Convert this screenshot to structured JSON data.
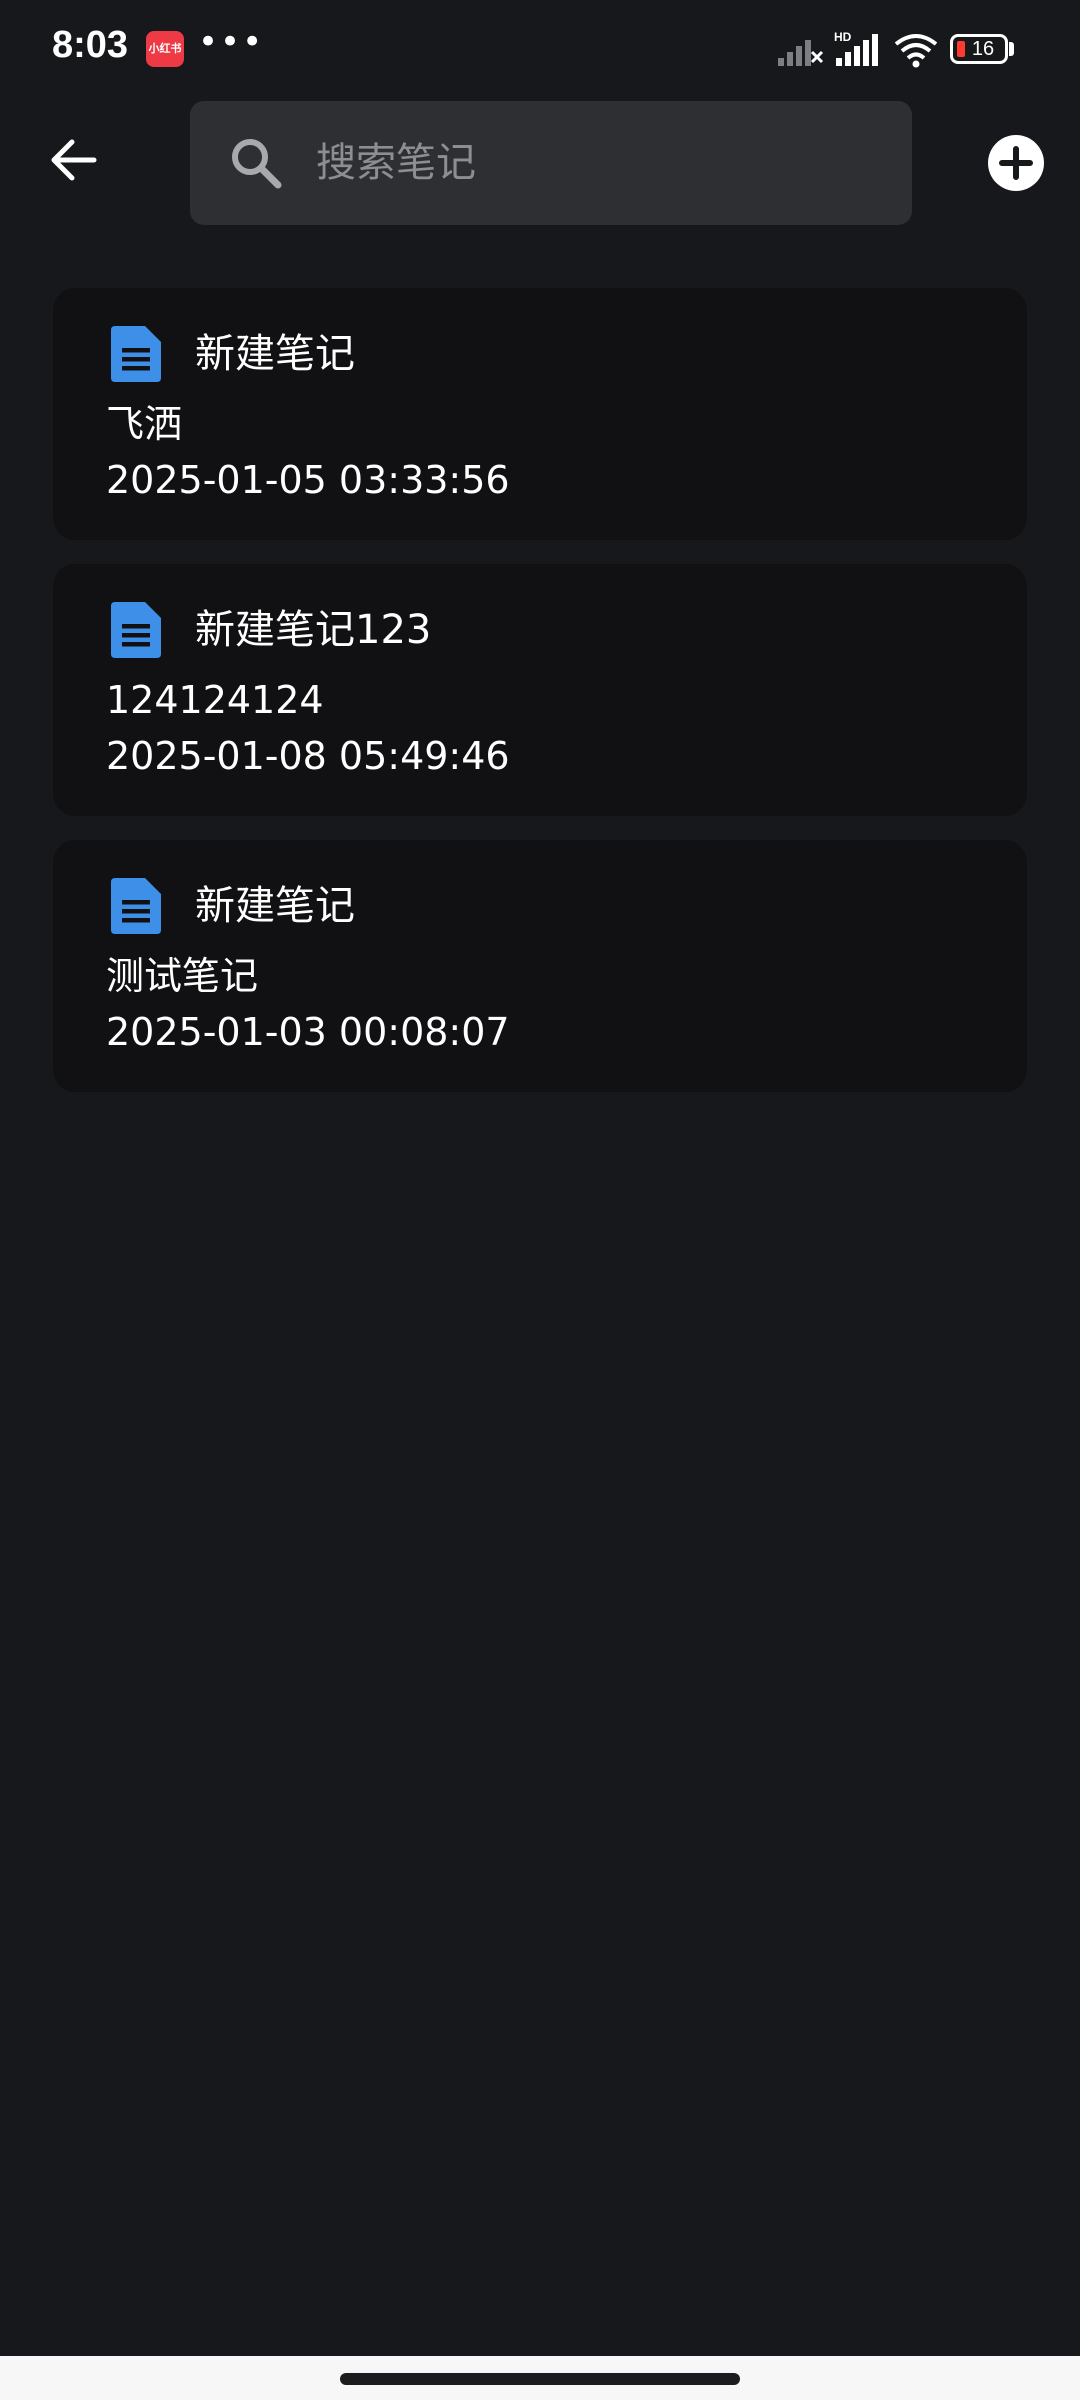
{
  "status_bar": {
    "time": "8:03",
    "app_badge": "小红书",
    "battery": "16"
  },
  "header": {
    "search_placeholder": "搜索笔记"
  },
  "notes": [
    {
      "title": "新建笔记",
      "content": "飞洒",
      "date": "2025-01-05 03:33:56"
    },
    {
      "title": "新建笔记123",
      "content": "124124124",
      "date": "2025-01-08 05:49:46"
    },
    {
      "title": "新建笔记",
      "content": "测试笔记",
      "date": "2025-01-03 00:08:07"
    }
  ],
  "colors": {
    "background": "#17181b",
    "card": "#111113",
    "search_box": "#2e2f33",
    "note_icon": "#3e8fe8",
    "app_badge": "#ee3a45"
  }
}
